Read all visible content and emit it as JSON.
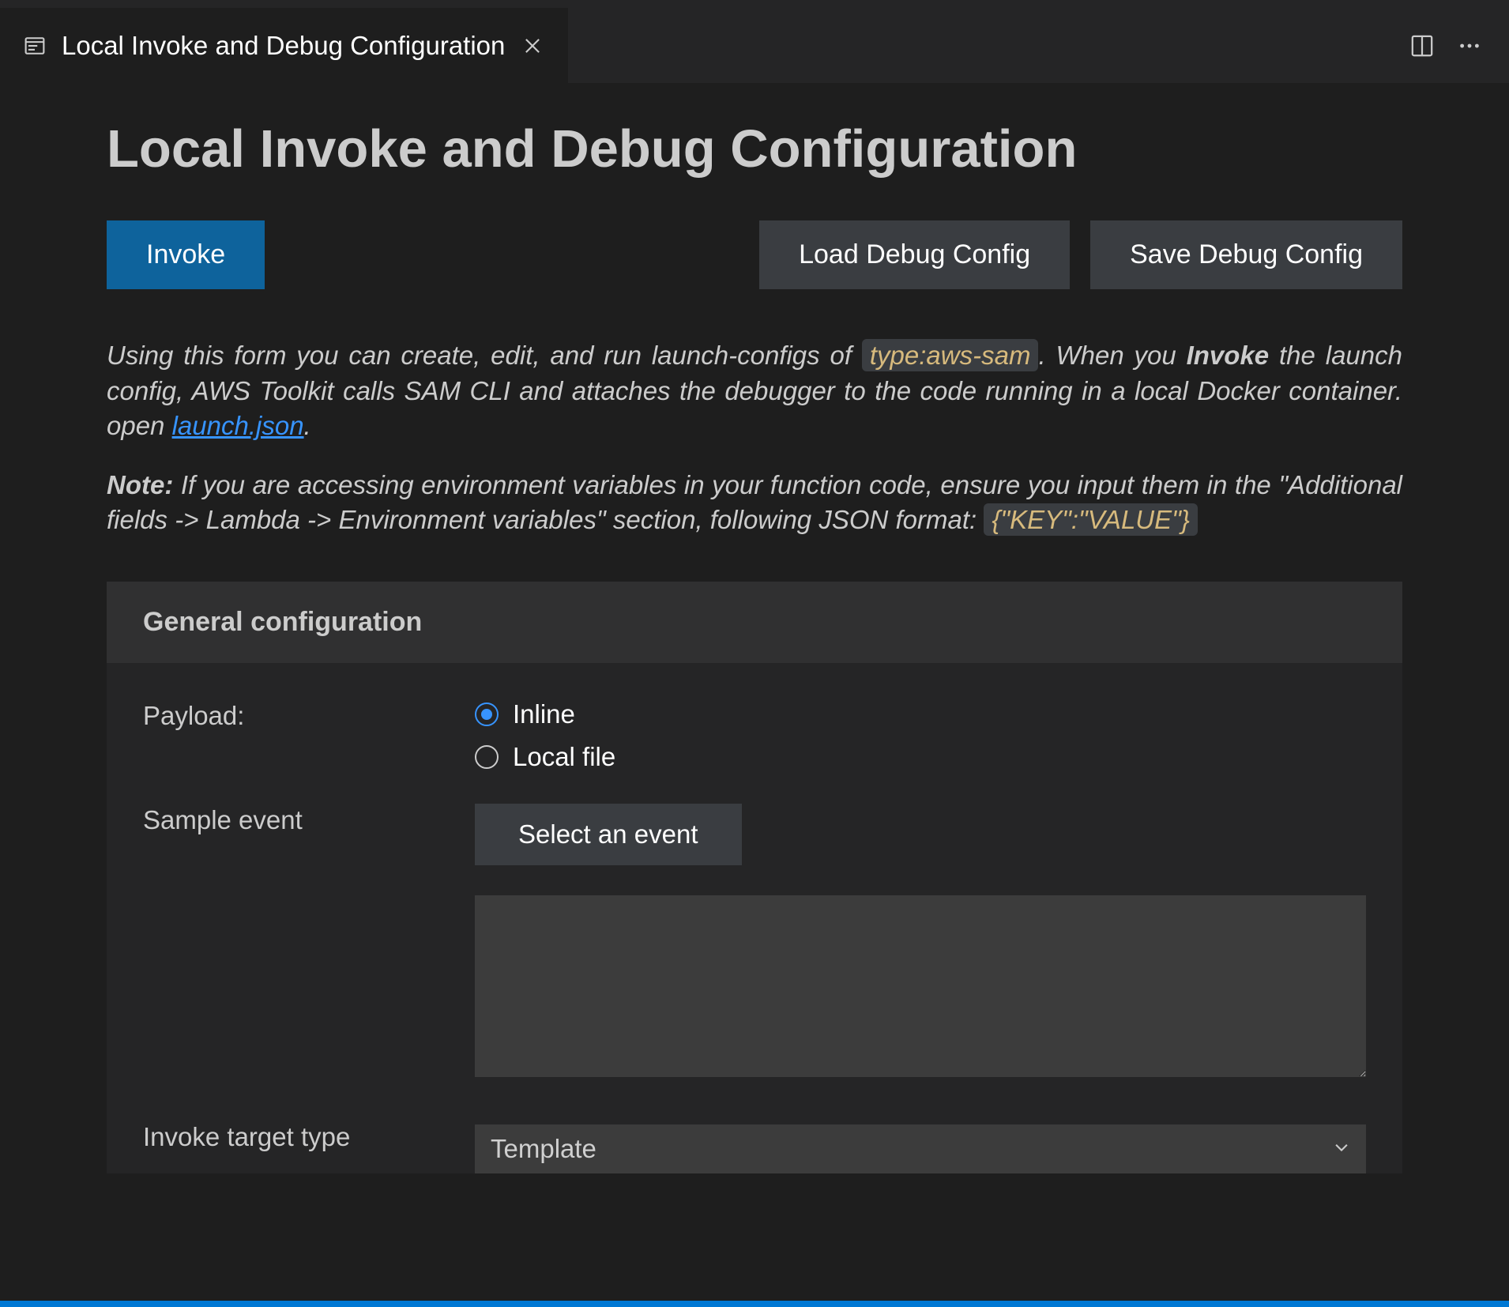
{
  "tab": {
    "title": "Local Invoke and Debug Configuration"
  },
  "page": {
    "title": "Local Invoke and Debug Configuration"
  },
  "buttons": {
    "invoke": "Invoke",
    "loadDebug": "Load Debug Config",
    "saveDebug": "Save Debug Config"
  },
  "description": {
    "part1": "Using this form you can create, edit, and run launch-configs of ",
    "typeChip": "type:aws-sam",
    "part2": ". When you ",
    "invokeWord": "Invoke",
    "part3": " the launch config, AWS Toolkit calls SAM CLI and attaches the debugger to the code running in a local Docker container. open ",
    "linkText": "launch.json",
    "part4": "."
  },
  "note": {
    "label": "Note:",
    "body": " If you are accessing environment variables in your function code, ensure you input them in the \"Additional fields -> Lambda -> Environment variables\" section, following JSON format: ",
    "example": "{\"KEY\":\"VALUE\"}"
  },
  "panel": {
    "title": "General configuration",
    "payload": {
      "label": "Payload:",
      "options": {
        "inline": "Inline",
        "localFile": "Local file"
      }
    },
    "sampleEvent": {
      "label": "Sample event",
      "button": "Select an event"
    },
    "invokeTargetType": {
      "label": "Invoke target type",
      "value": "Template"
    }
  }
}
